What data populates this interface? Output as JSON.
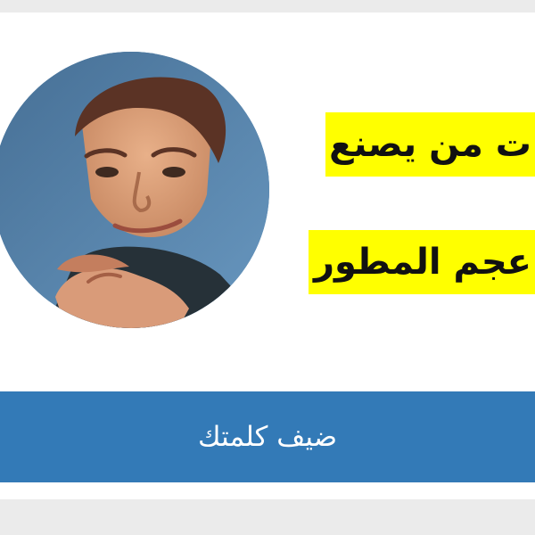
{
  "promo": {
    "line1": "ت من يصنع",
    "line2": "عجم المطور"
  },
  "cta": {
    "label": "ضيف كلمتك"
  },
  "colors": {
    "highlight": "#ffff00",
    "button": "#337ab7",
    "page_background": "#ebebeb",
    "card_background": "#ffffff"
  },
  "image": {
    "subject": "man pointing at viewer portrait"
  }
}
